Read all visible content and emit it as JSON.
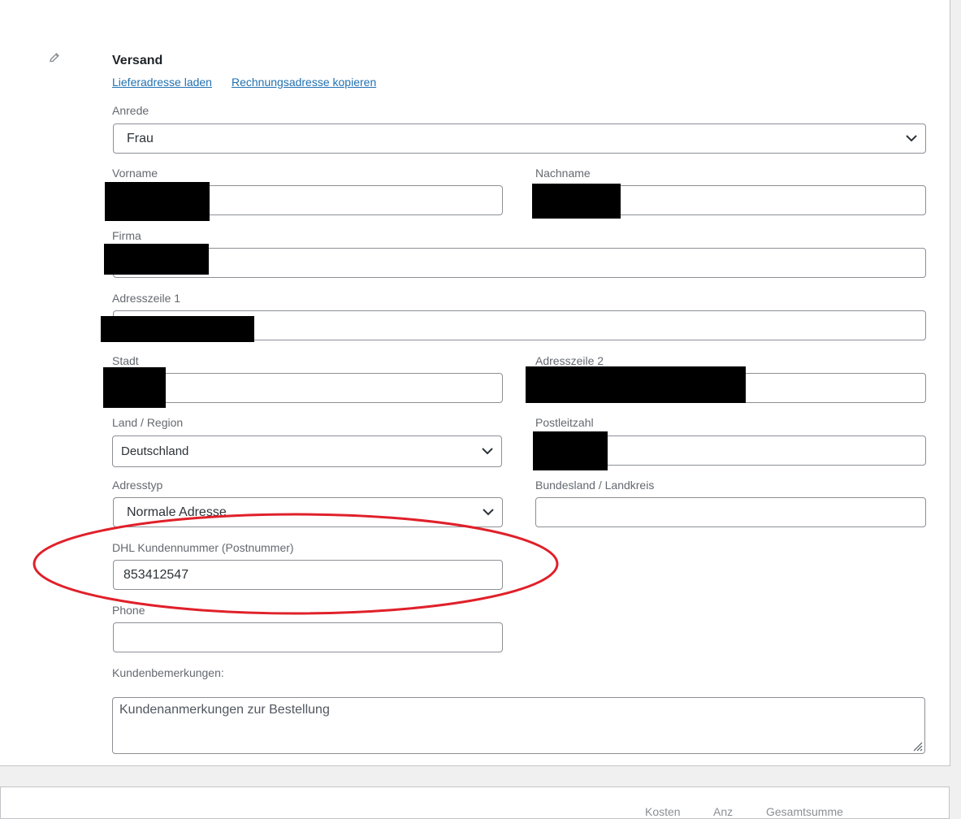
{
  "shipping": {
    "title": "Versand",
    "load_shipping_link": "Lieferadresse laden",
    "copy_billing_link": "Rechnungsadresse kopieren",
    "salutation_label": "Anrede",
    "salutation_value": "Frau",
    "first_name_label": "Vorname",
    "last_name_label": "Nachname",
    "company_label": "Firma",
    "address1_label": "Adresszeile 1",
    "city_label": "Stadt",
    "address2_label": "Adresszeile 2",
    "country_label": "Land / Region",
    "country_value": "Deutschland",
    "postcode_label": "Postleitzahl",
    "address_type_label": "Adresstyp",
    "address_type_value": "Normale Adresse",
    "state_label": "Bundesland / Landkreis",
    "state_value": "",
    "dhl_label": "DHL Kundennummer (Postnummer)",
    "dhl_value": "853412547",
    "phone_label": "Phone",
    "phone_value": "",
    "notes_label": "Kundenbemerkungen:",
    "notes_placeholder": "Kundenanmerkungen zur Bestellung"
  },
  "footer": {
    "col_cost": "Kosten",
    "col_qty": "Anz",
    "col_total": "Gesamtsumme"
  },
  "icons": {
    "edit": "pencil-icon",
    "select": "chevron-down-icon",
    "resize": "resize-grip-icon"
  },
  "colors": {
    "link": "#2271b1",
    "highlight": "#e0202a",
    "redaction": "#000000"
  }
}
